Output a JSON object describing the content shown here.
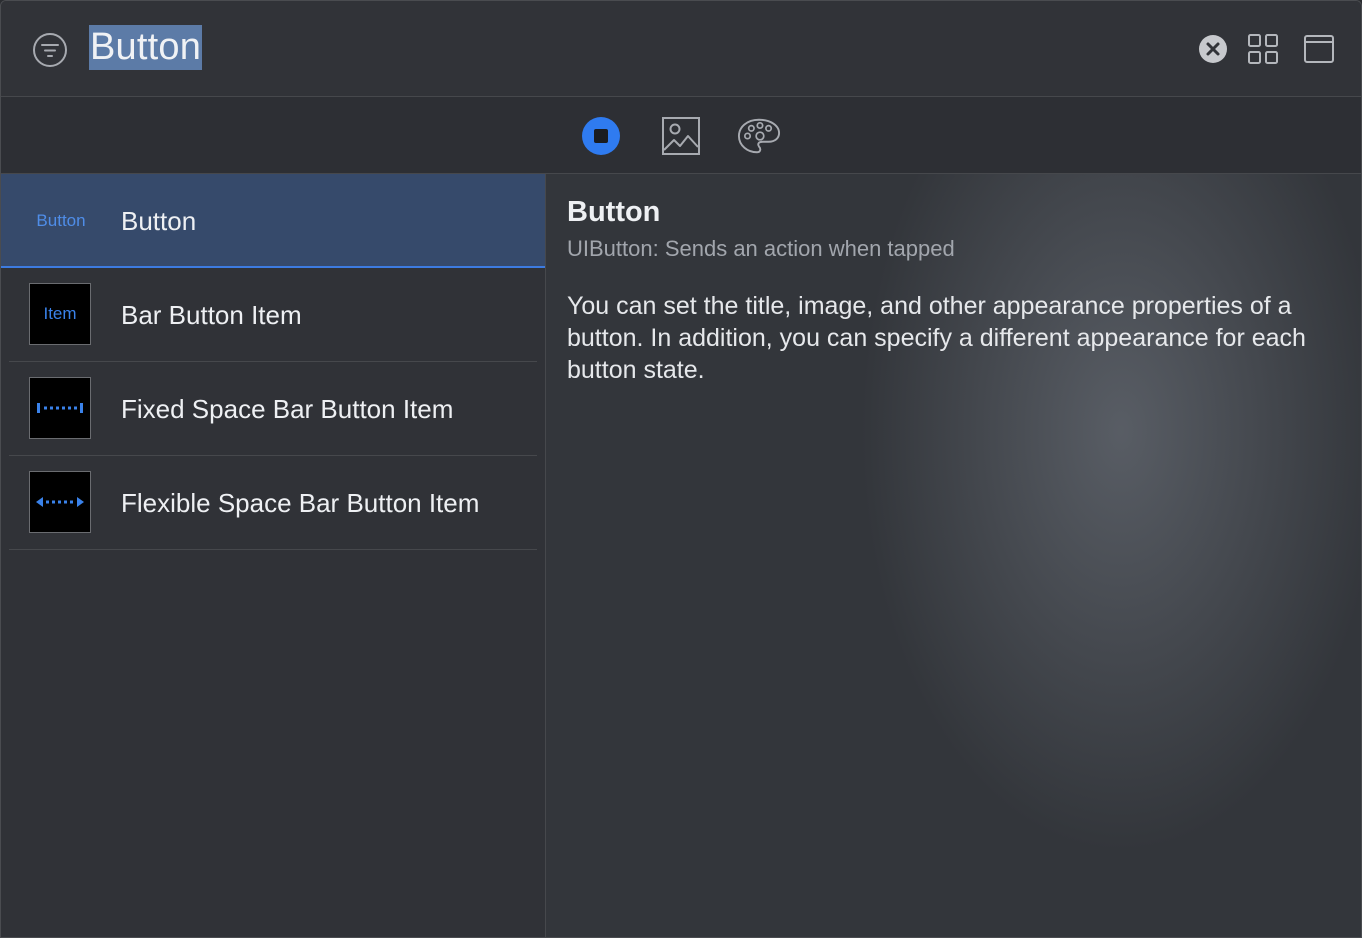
{
  "search": {
    "value": "Button"
  },
  "tabs": [
    {
      "name": "objects",
      "icon": "square-in-circle-icon",
      "selected": true
    },
    {
      "name": "media",
      "icon": "image-icon",
      "selected": false
    },
    {
      "name": "colors",
      "icon": "palette-icon",
      "selected": false
    }
  ],
  "list": {
    "items": [
      {
        "title": "Button",
        "thumbnail_text": "Button",
        "selected": true
      },
      {
        "title": "Bar Button Item",
        "thumbnail_text": "Item",
        "selected": false
      },
      {
        "title": "Fixed Space Bar Button Item",
        "thumbnail_icon": "fixed-space-icon",
        "selected": false
      },
      {
        "title": "Flexible Space Bar Button Item",
        "thumbnail_icon": "flexible-space-icon",
        "selected": false
      }
    ]
  },
  "detail": {
    "title": "Button",
    "subtitle": "UIButton: Sends an action when tapped",
    "description": "You can set the title, image, and other appearance properties of a button. In addition, you can specify a different appearance for each button state."
  },
  "colors": {
    "accent": "#3d7be0",
    "selection_bg": "#364a6b",
    "search_highlight": "#5c7ba7"
  }
}
